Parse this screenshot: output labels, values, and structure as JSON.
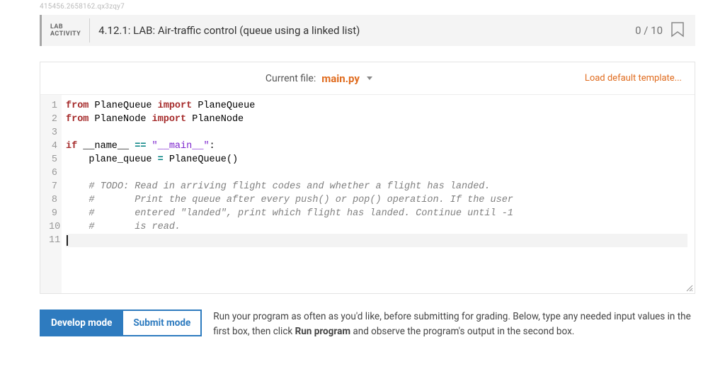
{
  "watermark": "415456.2658162.qx3zqy7",
  "header": {
    "activity_label_line1": "LAB",
    "activity_label_line2": "ACTIVITY",
    "title": "4.12.1: LAB: Air-traffic control (queue using a linked list)",
    "score": "0 / 10"
  },
  "filebar": {
    "label": "Current file:",
    "filename": "main.py",
    "load_default": "Load default template..."
  },
  "code": {
    "lines": [
      {
        "n": 1,
        "segs": [
          {
            "t": "from",
            "c": "kw-red"
          },
          {
            "t": " PlaneQueue "
          },
          {
            "t": "import",
            "c": "kw-red"
          },
          {
            "t": " PlaneQueue"
          }
        ]
      },
      {
        "n": 2,
        "segs": [
          {
            "t": "from",
            "c": "kw-red"
          },
          {
            "t": " PlaneNode "
          },
          {
            "t": "import",
            "c": "kw-red"
          },
          {
            "t": " PlaneNode"
          }
        ]
      },
      {
        "n": 3,
        "segs": []
      },
      {
        "n": 4,
        "segs": [
          {
            "t": "if",
            "c": "kw-red"
          },
          {
            "t": " __name__ "
          },
          {
            "t": "==",
            "c": "kw-teal"
          },
          {
            "t": " "
          },
          {
            "t": "\"__main__\"",
            "c": "str-purple"
          },
          {
            "t": ":"
          }
        ]
      },
      {
        "n": 5,
        "segs": [
          {
            "t": "    plane_queue "
          },
          {
            "t": "=",
            "c": "kw-teal"
          },
          {
            "t": " PlaneQueue()"
          }
        ]
      },
      {
        "n": 6,
        "segs": []
      },
      {
        "n": 7,
        "segs": [
          {
            "t": "    "
          },
          {
            "t": "# TODO: Read in arriving flight codes and whether a flight has landed.",
            "c": "comment"
          }
        ]
      },
      {
        "n": 8,
        "segs": [
          {
            "t": "    "
          },
          {
            "t": "#       Print the queue after every push() or pop() operation. If the user",
            "c": "comment"
          }
        ]
      },
      {
        "n": 9,
        "segs": [
          {
            "t": "    "
          },
          {
            "t": "#       entered \"landed\", print which flight has landed. Continue until -1",
            "c": "comment"
          }
        ]
      },
      {
        "n": 10,
        "segs": [
          {
            "t": "    "
          },
          {
            "t": "#       is read.",
            "c": "comment"
          }
        ]
      },
      {
        "n": 11,
        "segs": [],
        "hl": true,
        "cursor": true
      }
    ]
  },
  "controls": {
    "develop_mode": "Develop mode",
    "submit_mode": "Submit mode",
    "instructions_pre": "Run your program as often as you'd like, before submitting for grading. Below, type any needed input values in the first box, then click ",
    "instructions_bold": "Run program",
    "instructions_post": " and observe the program's output in the second box."
  }
}
